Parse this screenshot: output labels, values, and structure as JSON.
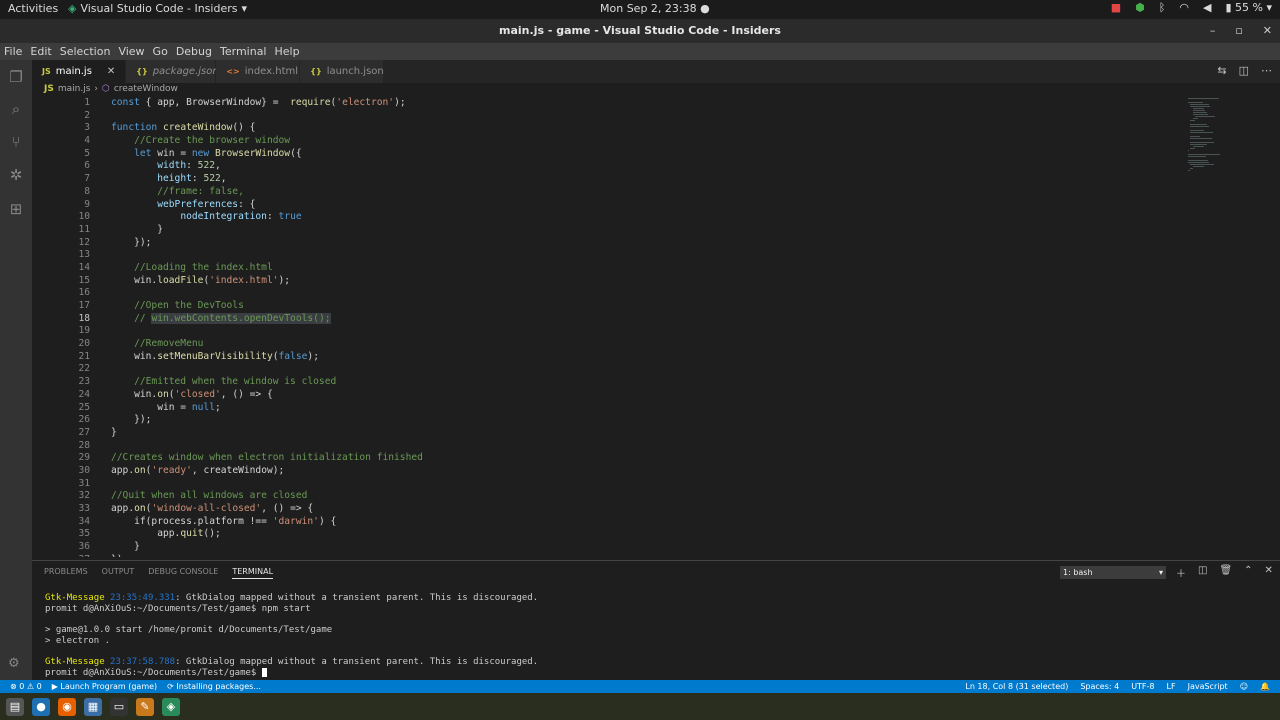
{
  "topbar": {
    "activities": "Activities",
    "app_name": "Visual Studio Code - Insiders",
    "clock": "Mon Sep  2, 23:38",
    "battery": "55 %"
  },
  "window": {
    "title": "main.js - game - Visual Studio Code - Insiders"
  },
  "menu": [
    "File",
    "Edit",
    "Selection",
    "View",
    "Go",
    "Debug",
    "Terminal",
    "Help"
  ],
  "tabs": [
    {
      "icon": "JS",
      "label": "main.js",
      "active": true
    },
    {
      "icon": "{}",
      "label": "package.json",
      "active": false
    },
    {
      "icon": "<>",
      "label": "index.html",
      "active": false
    },
    {
      "icon": "{}",
      "label": "launch.json",
      "active": false
    }
  ],
  "breadcrumb": {
    "file": "main.js",
    "symbol": "createWindow"
  },
  "code": {
    "current_line": 18,
    "lines": [
      "const { app, BrowserWindow} =  require('electron');",
      "",
      "function createWindow() {",
      "    //Create the browser window",
      "    let win = new BrowserWindow({",
      "        width: 522,",
      "        height: 522,",
      "        //frame: false,",
      "        webPreferences: {",
      "            nodeIntegration: true",
      "        }",
      "    });",
      "",
      "    //Loading the index.html",
      "    win.loadFile('index.html');",
      "",
      "    //Open the DevTools",
      "    // win.webContents.openDevTools();",
      "",
      "    //RemoveMenu",
      "    win.setMenuBarVisibility(false);",
      "",
      "    //Emitted when the window is closed",
      "    win.on('closed', () => {",
      "        win = null;",
      "    });",
      "}",
      "",
      "//Creates window when electron initialization finished",
      "app.on('ready', createWindow);",
      "",
      "//Quit when all windows are closed",
      "app.on('window-all-closed', () => {",
      "    if(process.platform !== 'darwin') {",
      "        app.quit();",
      "    }",
      "});"
    ]
  },
  "panel": {
    "tabs": [
      "PROBLEMS",
      "OUTPUT",
      "DEBUG CONSOLE",
      "TERMINAL"
    ],
    "active_tab": "TERMINAL",
    "terminal_select": "1: bash",
    "terminal_lines": [
      {
        "prefix": "Gtk-",
        "tag": "Message",
        "time": "23:35:49.331",
        "msg": ": GtkDialog mapped without a transient parent. This is discouraged."
      },
      {
        "text": "promit d@AnXiOuS:~/Documents/Test/game$ npm start"
      },
      {
        "text": ""
      },
      {
        "text": "> game@1.0.0 start /home/promit d/Documents/Test/game"
      },
      {
        "text": "> electron ."
      },
      {
        "text": ""
      },
      {
        "prefix": "Gtk-",
        "tag": "Message",
        "time": "23:37:58.788",
        "msg": ": GtkDialog mapped without a transient parent. This is discouraged."
      },
      {
        "text": "promit d@AnXiOuS:~/Documents/Test/game$ ",
        "cursor": true
      }
    ]
  },
  "status": {
    "errors": "0",
    "warnings": "0",
    "launch": "Launch Program (game)",
    "installing": "Installing packages...",
    "position": "Ln 18, Col 8 (31 selected)",
    "spaces": "Spaces: 4",
    "encoding": "UTF-8",
    "eol": "LF",
    "language": "JavaScript"
  }
}
